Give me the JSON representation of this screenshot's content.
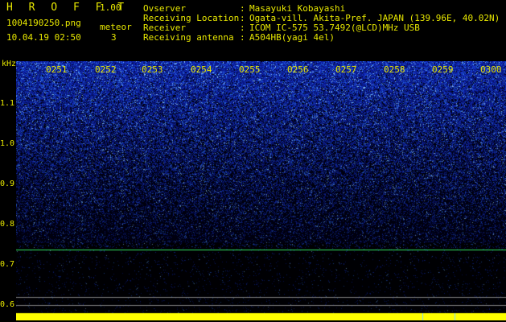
{
  "header": {
    "brand": "H R O F F T",
    "version": "1.00",
    "filename": "1004190250.png",
    "datetime": "10.04.19 02:50",
    "meteor_label": "meteor",
    "meteor_count": "3"
  },
  "info": [
    {
      "key": "Ovserver",
      "value": "Masayuki Kobayashi"
    },
    {
      "key": "Receiving Location",
      "value": "Ogata-vill. Akita-Pref. JAPAN (139.96E, 40.02N)"
    },
    {
      "key": "Receiver",
      "value": "ICOM IC-575 53.7492(@LCD)MHz USB"
    },
    {
      "key": "Receiving antenna",
      "value": "A504HB(yagi 4el)"
    }
  ],
  "axis": {
    "unit": "kHz",
    "y_labels": [
      "1.1",
      "1.0",
      "0.9",
      "0.8",
      "0.7",
      "0.6"
    ],
    "time_labels": [
      "0251",
      "0252",
      "0253",
      "0254",
      "0255",
      "0256",
      "0257",
      "0258",
      "0259",
      "0300"
    ]
  },
  "colors": {
    "text": "#e8e800",
    "signal_line": "#30e060",
    "bottom_bar": "#ffff00",
    "noise_blue": "#2030c0"
  }
}
